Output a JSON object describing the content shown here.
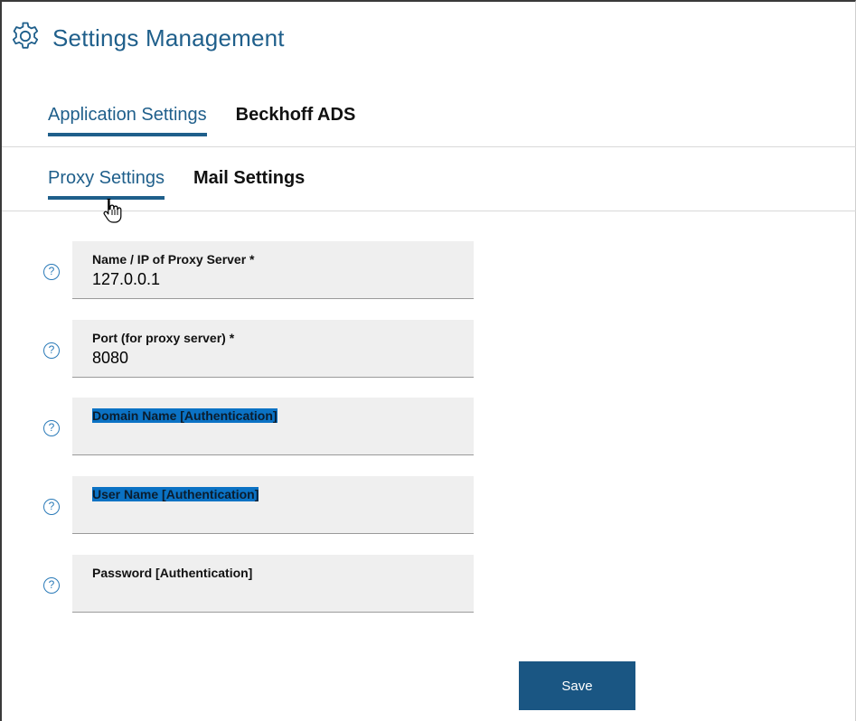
{
  "header": {
    "title": "Settings Management",
    "icon": "gear-icon",
    "accent": "#1f5f8b"
  },
  "primary_tabs": [
    {
      "label": "Application Settings",
      "active": true
    },
    {
      "label": "Beckhoff ADS",
      "active": false
    }
  ],
  "secondary_tabs": [
    {
      "label": "Proxy Settings",
      "active": true
    },
    {
      "label": "Mail Settings",
      "active": false
    }
  ],
  "fields": [
    {
      "label": "Name / IP of Proxy Server *",
      "value": "127.0.0.1",
      "highlighted": false,
      "help_icon": "help-icon"
    },
    {
      "label": "Port (for proxy server) *",
      "value": "8080",
      "highlighted": false,
      "help_icon": "help-icon"
    },
    {
      "label": "Domain Name [Authentication]",
      "value": "",
      "highlighted": true,
      "help_icon": "help-icon"
    },
    {
      "label": "User Name [Authentication]",
      "value": "",
      "highlighted": true,
      "help_icon": "help-icon"
    },
    {
      "label": "Password [Authentication]",
      "value": "",
      "highlighted": false,
      "help_icon": "help-icon"
    }
  ],
  "actions": {
    "save_label": "Save",
    "save_color": "#1a5683"
  },
  "help_glyph": "?"
}
